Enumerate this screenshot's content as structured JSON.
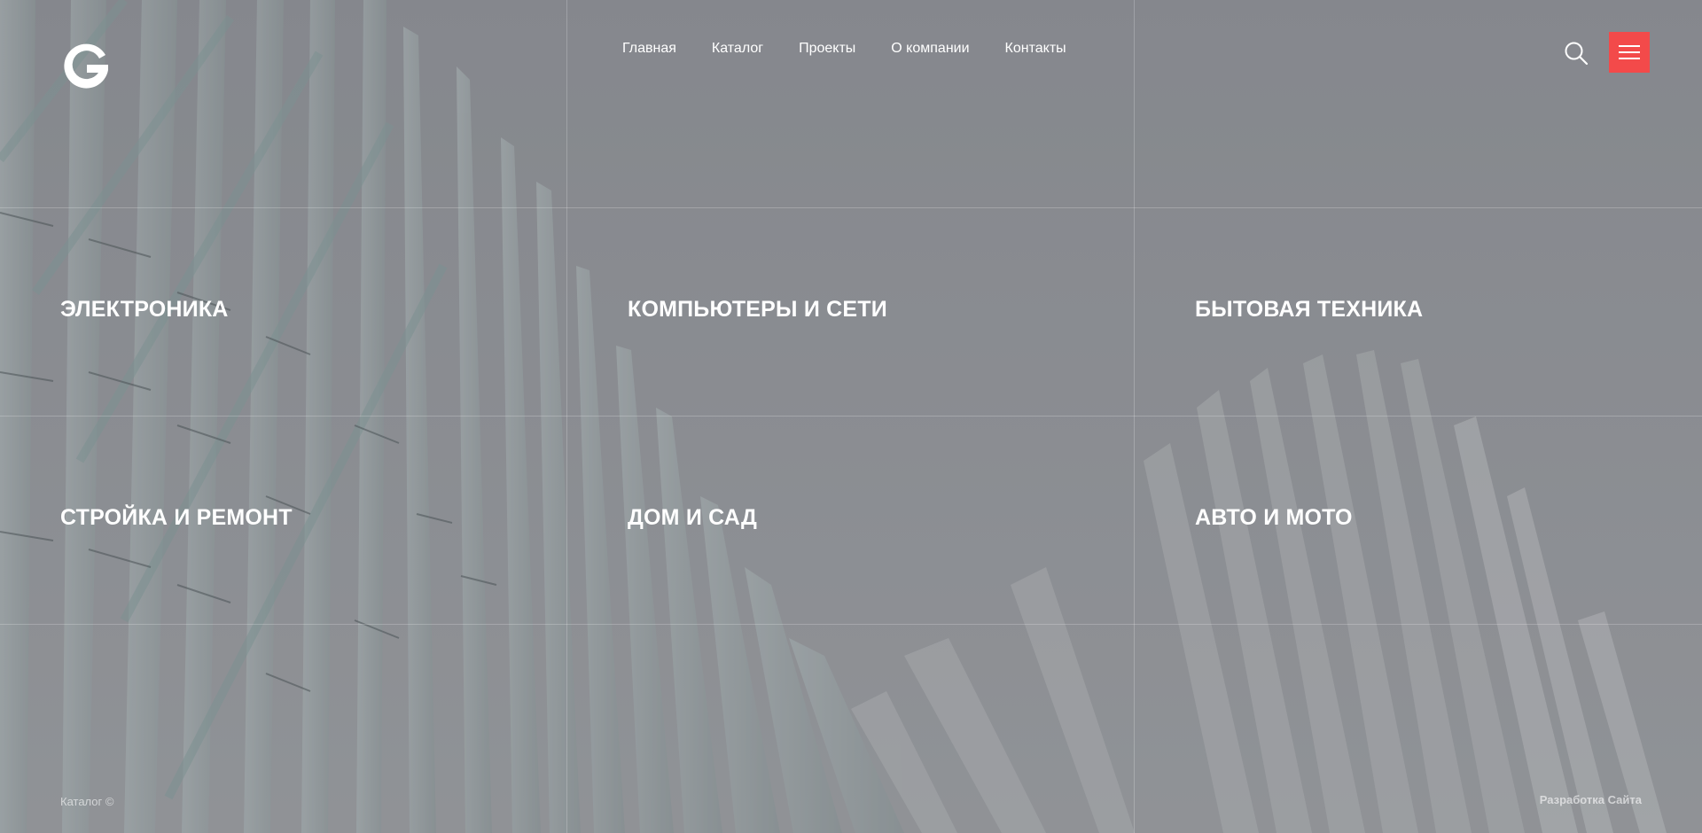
{
  "header": {
    "logo_letter": "G",
    "nav": [
      "Главная",
      "Каталог",
      "Проекты",
      "О компании",
      "Контакты"
    ],
    "search_icon": "search-icon",
    "menu_icon": "hamburger-menu-icon",
    "menu_button_color": "#f34a4a"
  },
  "categories": [
    "ЭЛЕКТРОНИКА",
    "КОМПЬЮТЕРЫ И СЕТИ",
    "БЫТОВАЯ ТЕХНИКА",
    "СТРОЙКА И РЕМОНТ",
    "ДОМ И САД",
    "АВТО И МОТО"
  ],
  "footer": {
    "copyright": "Каталог ©",
    "developer_link": "Разработка Сайта"
  }
}
